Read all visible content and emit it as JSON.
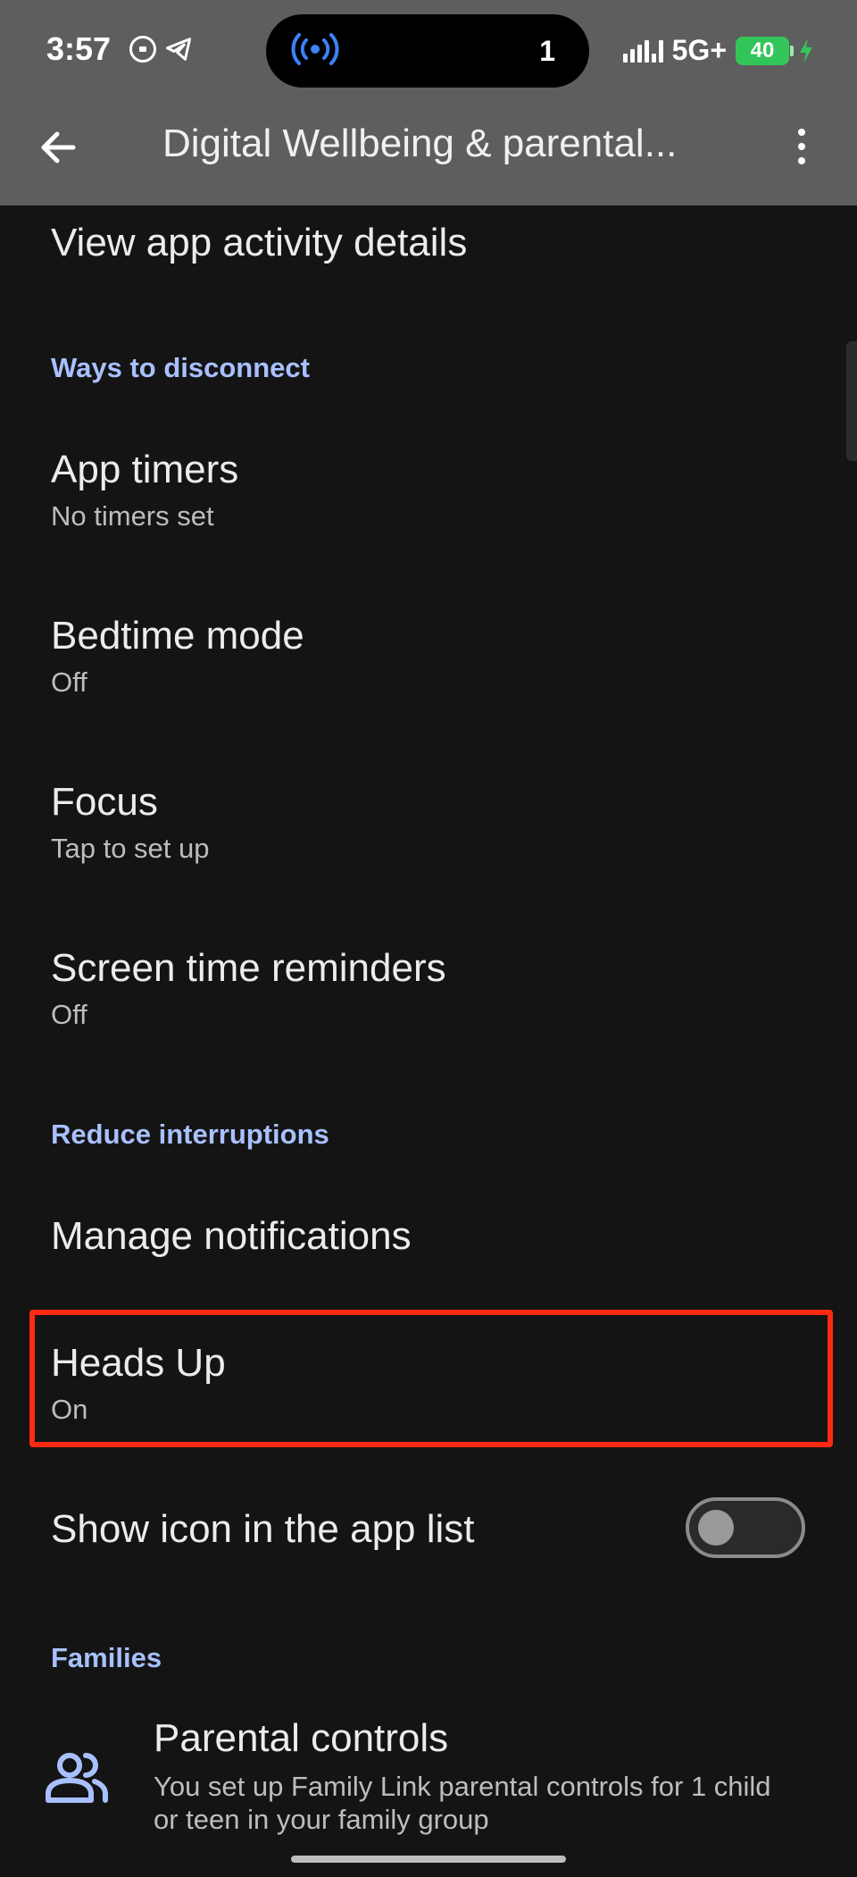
{
  "status_bar": {
    "time": "3:57",
    "notification_count": "1",
    "network": "5G+",
    "battery": "40"
  },
  "app_bar": {
    "title": "Digital Wellbeing & parental..."
  },
  "items": {
    "view_activity": {
      "title": "View app activity details"
    },
    "ways_header": "Ways to disconnect",
    "app_timers": {
      "title": "App timers",
      "subtitle": "No timers set"
    },
    "bedtime": {
      "title": "Bedtime mode",
      "subtitle": "Off"
    },
    "focus": {
      "title": "Focus",
      "subtitle": "Tap to set up"
    },
    "screen_time": {
      "title": "Screen time reminders",
      "subtitle": "Off"
    },
    "reduce_header": "Reduce interruptions",
    "manage_notifications": {
      "title": "Manage notifications"
    },
    "heads_up": {
      "title": "Heads Up",
      "subtitle": "On"
    },
    "show_icon": {
      "title": "Show icon in the app list",
      "enabled": false
    },
    "families_header": "Families",
    "parental_controls": {
      "title": "Parental controls",
      "subtitle": "You set up Family Link parental controls for 1 child or teen in your family group"
    }
  },
  "colors": {
    "accent": "#a8c0ff",
    "highlight": "#ff2a12",
    "battery": "#32c65a",
    "hotspot": "#3b82f6"
  }
}
